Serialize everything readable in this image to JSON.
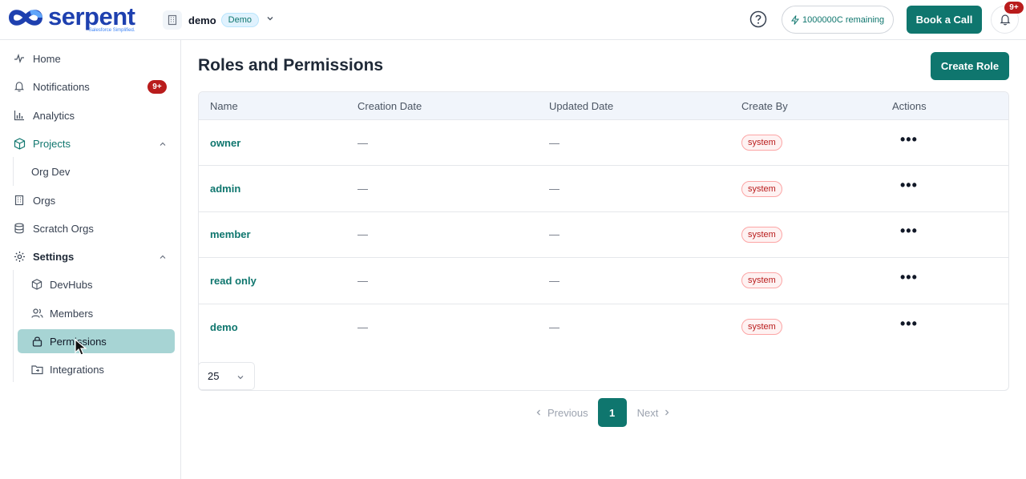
{
  "header": {
    "logo_text": "serpent",
    "logo_tagline": "Salesforce Simplified.",
    "workspace_name": "demo",
    "workspace_badge": "Demo",
    "credits_label": "1000000C remaining",
    "book_call_label": "Book a Call",
    "notification_badge": "9+"
  },
  "sidebar": {
    "home": "Home",
    "notifications": "Notifications",
    "notifications_badge": "9+",
    "analytics": "Analytics",
    "projects": "Projects",
    "project_children": [
      "Org Dev"
    ],
    "orgs": "Orgs",
    "scratch_orgs": "Scratch Orgs",
    "settings": "Settings",
    "settings_children": [
      "DevHubs",
      "Members",
      "Permissions",
      "Integrations"
    ]
  },
  "main": {
    "title": "Roles and Permissions",
    "create_role_label": "Create Role",
    "columns": [
      "Name",
      "Creation Date",
      "Updated Date",
      "Create By",
      "Actions"
    ],
    "rows": [
      {
        "name": "owner",
        "created": "—",
        "updated": "—",
        "created_by": "system",
        "actions": "•••"
      },
      {
        "name": "admin",
        "created": "—",
        "updated": "—",
        "created_by": "system",
        "actions": "•••"
      },
      {
        "name": "member",
        "created": "—",
        "updated": "—",
        "created_by": "system",
        "actions": "•••"
      },
      {
        "name": "read only",
        "created": "—",
        "updated": "—",
        "created_by": "system",
        "actions": "•••"
      },
      {
        "name": "demo",
        "created": "—",
        "updated": "—",
        "created_by": "system",
        "actions": "•••"
      }
    ],
    "page_size": "25",
    "pagination": {
      "previous": "Previous",
      "current": "1",
      "next": "Next"
    }
  },
  "colors": {
    "brand": "#0f766e",
    "logo": "#1e40af",
    "danger": "#b91c1c",
    "active_nav": "#a7d4d4"
  }
}
